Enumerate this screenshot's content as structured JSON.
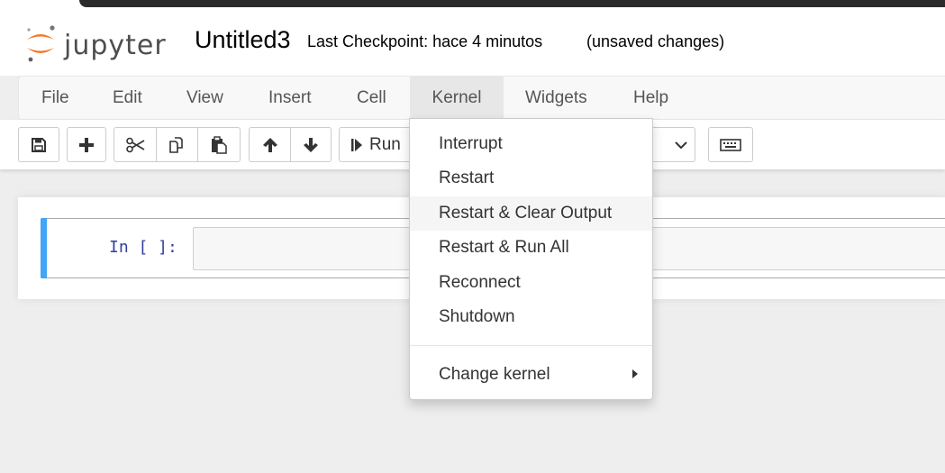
{
  "header": {
    "logo_text": "jupyter",
    "notebook_title": "Untitled3",
    "checkpoint": "Last Checkpoint: hace 4 minutos",
    "status": "(unsaved changes)"
  },
  "menubar": {
    "items": [
      {
        "label": "File"
      },
      {
        "label": "Edit"
      },
      {
        "label": "View"
      },
      {
        "label": "Insert"
      },
      {
        "label": "Cell"
      },
      {
        "label": "Kernel",
        "active": true
      },
      {
        "label": "Widgets"
      },
      {
        "label": "Help"
      }
    ]
  },
  "toolbar": {
    "save_icon": "save-icon",
    "add_icon": "plus-icon",
    "cut_icon": "scissors-icon",
    "copy_icon": "copy-icon",
    "paste_icon": "paste-icon",
    "up_icon": "arrow-up-icon",
    "down_icon": "arrow-down-icon",
    "run_label": "Run",
    "keyboard_icon": "keyboard-icon"
  },
  "cell": {
    "prompt": "In [ ]:",
    "accent_color": "#42a5f5"
  },
  "kernel_menu": {
    "items": [
      {
        "label": "Interrupt"
      },
      {
        "label": "Restart"
      },
      {
        "label": "Restart & Clear Output",
        "hover": true
      },
      {
        "label": "Restart & Run All"
      },
      {
        "label": "Reconnect"
      },
      {
        "label": "Shutdown"
      }
    ],
    "submenu_label": "Change kernel"
  }
}
